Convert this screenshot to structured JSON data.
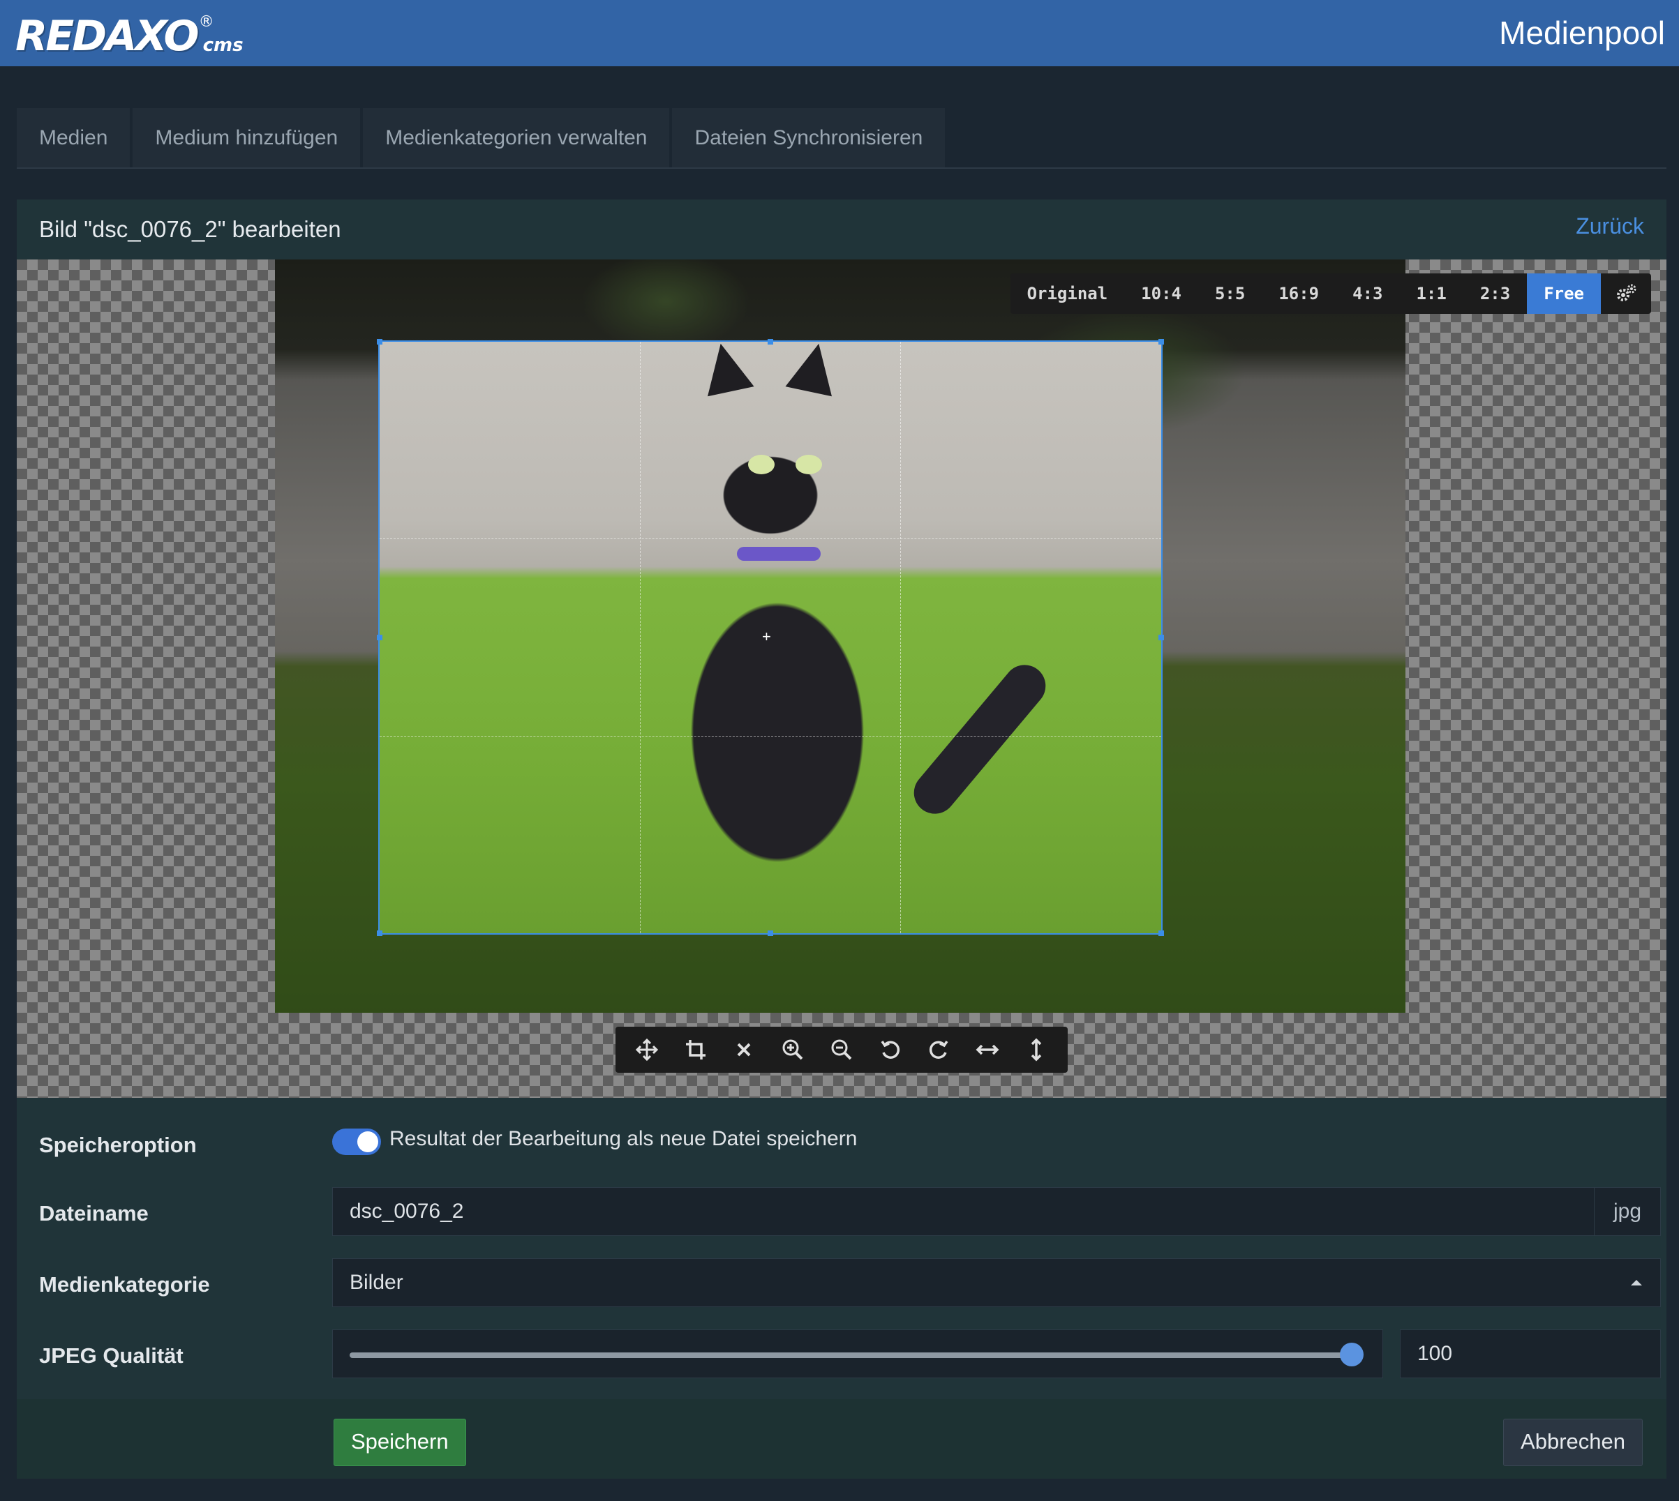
{
  "header": {
    "logo_main": "REDAXO",
    "logo_reg": "®",
    "logo_sub": "cms",
    "title": "Medienpool"
  },
  "tabs": [
    {
      "label": "Medien"
    },
    {
      "label": "Medium hinzufügen"
    },
    {
      "label": "Medienkategorien verwalten"
    },
    {
      "label": "Dateien Synchronisieren"
    }
  ],
  "panel": {
    "title": "Bild \"dsc_0076_2\" bearbeiten",
    "back_label": "Zurück"
  },
  "cropper": {
    "aspect_ratios": [
      "Original",
      "10:4",
      "5:5",
      "16:9",
      "4:3",
      "1:1",
      "2:3",
      "Free"
    ],
    "active_ratio": "Free",
    "settings_icon": "gears-icon",
    "tools": [
      {
        "name": "move-icon"
      },
      {
        "name": "crop-icon"
      },
      {
        "name": "clear-icon"
      },
      {
        "name": "zoom-in-icon"
      },
      {
        "name": "zoom-out-icon"
      },
      {
        "name": "rotate-left-icon"
      },
      {
        "name": "rotate-right-icon"
      },
      {
        "name": "flip-horizontal-icon"
      },
      {
        "name": "flip-vertical-icon"
      }
    ]
  },
  "form": {
    "save_option": {
      "label": "Speicheroption",
      "toggle_on": true,
      "toggle_text": "Resultat der Bearbeitung als neue Datei speichern"
    },
    "filename": {
      "label": "Dateiname",
      "value": "dsc_0076_2",
      "extension": "jpg"
    },
    "category": {
      "label": "Medienkategorie",
      "value": "Bilder"
    },
    "jpeg_quality": {
      "label": "JPEG Qualität",
      "value": "100",
      "slider_fraction": 1.0
    }
  },
  "footer": {
    "save_label": "Speichern",
    "cancel_label": "Abbrechen"
  },
  "colors": {
    "brand": "#3264a6",
    "accent": "#3a7bd5",
    "save": "#2f7d3f"
  }
}
